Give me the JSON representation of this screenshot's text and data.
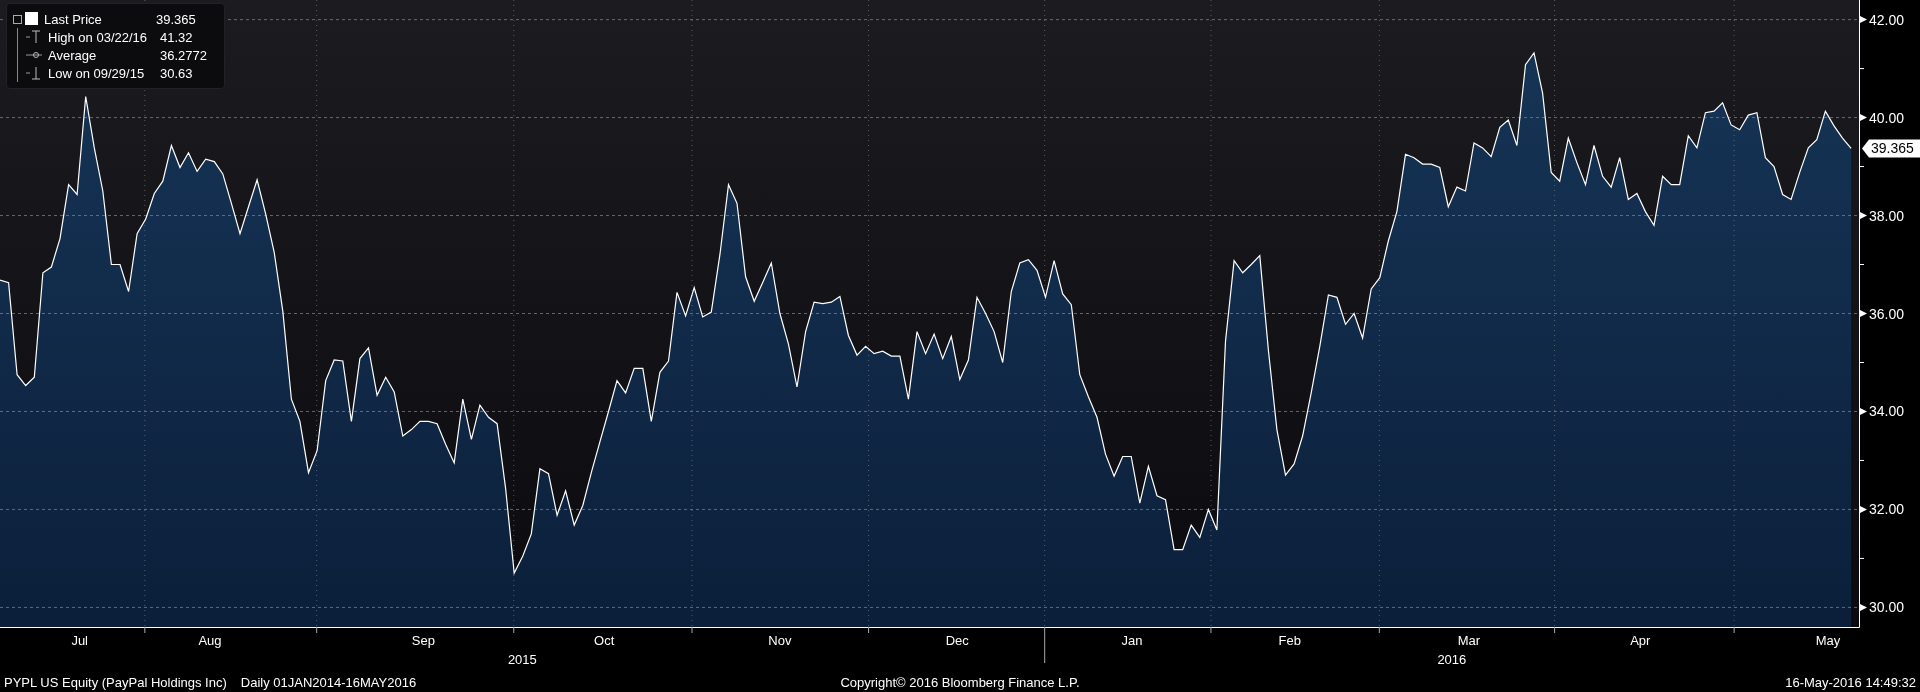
{
  "legend": [
    {
      "kind": "last",
      "value": "39.365"
    },
    {
      "kind": "high",
      "label": "High on 03/22/16",
      "value": "41.32"
    },
    {
      "kind": "average",
      "label": "Average",
      "value": "36.2772"
    },
    {
      "kind": "low",
      "label": "Low on 09/29/15",
      "value": "30.63"
    }
  ],
  "last_price_tag": "39.365",
  "x_axis_months": [
    "Jul",
    "Aug",
    "Sep",
    "Oct",
    "Nov",
    "Dec",
    "Jan",
    "Feb",
    "Mar",
    "Apr",
    "May"
  ],
  "chart_data": {
    "type": "area",
    "grid": true,
    "ylim": [
      29.6,
      42.4
    ],
    "yticks": [
      {
        "value": 30,
        "label": "30.00"
      },
      {
        "value": 32,
        "label": "32.00"
      },
      {
        "value": 34,
        "label": "34.00"
      },
      {
        "value": 36,
        "label": "36.00"
      },
      {
        "value": 38,
        "label": "38.00"
      },
      {
        "value": 40,
        "label": "40.00"
      },
      {
        "value": 42,
        "label": "42.00"
      }
    ],
    "series": [
      {
        "name": "Last Price",
        "color": "#ffffff",
        "values": [
          36.68,
          36.63,
          34.75,
          34.53,
          34.7,
          36.83,
          36.95,
          37.53,
          38.63,
          38.43,
          40.43,
          39.38,
          38.5,
          37.0,
          37.0,
          36.45,
          37.63,
          37.93,
          38.45,
          38.7,
          39.43,
          38.98,
          39.28,
          38.9,
          39.15,
          39.1,
          38.85,
          38.25,
          37.63,
          38.18,
          38.73,
          38.03,
          37.25,
          36.05,
          34.25,
          33.8,
          32.75,
          33.2,
          34.63,
          35.05,
          35.03,
          33.8,
          35.08,
          35.3,
          34.33,
          34.7,
          34.4,
          33.5,
          33.63,
          33.8,
          33.8,
          33.75,
          33.33,
          32.95,
          34.25,
          33.43,
          34.13,
          33.88,
          33.75,
          32.43,
          30.7,
          31.05,
          31.5,
          32.83,
          32.73,
          31.88,
          32.38,
          31.68,
          32.08,
          32.75,
          33.38,
          34.0,
          34.63,
          34.38,
          34.88,
          34.88,
          33.8,
          34.8,
          35.03,
          36.43,
          35.95,
          36.53,
          35.93,
          36.03,
          37.2,
          38.63,
          38.25,
          36.75,
          36.25,
          36.63,
          37.03,
          36.0,
          35.38,
          34.5,
          35.63,
          36.23,
          36.2,
          36.23,
          36.35,
          35.55,
          35.15,
          35.33,
          35.18,
          35.23,
          35.13,
          35.13,
          34.25,
          35.63,
          35.18,
          35.58,
          35.08,
          35.53,
          34.65,
          35.05,
          36.33,
          36.0,
          35.63,
          35.0,
          36.45,
          37.03,
          37.1,
          36.88,
          36.33,
          37.08,
          36.4,
          36.18,
          34.75,
          34.3,
          33.88,
          33.13,
          32.68,
          33.08,
          33.08,
          32.13,
          32.88,
          32.28,
          32.2,
          31.18,
          31.18,
          31.68,
          31.43,
          32.0,
          31.58,
          35.43,
          37.08,
          36.83,
          37.0,
          37.18,
          35.25,
          33.63,
          32.7,
          32.93,
          33.5,
          34.38,
          35.33,
          36.38,
          36.33,
          35.78,
          36.0,
          35.5,
          36.5,
          36.73,
          37.48,
          38.08,
          39.25,
          39.18,
          39.05,
          39.05,
          38.98,
          38.18,
          38.58,
          38.5,
          39.48,
          39.38,
          39.2,
          39.8,
          39.95,
          39.43,
          41.08,
          41.32,
          40.5,
          38.88,
          38.7,
          39.58,
          39.08,
          38.63,
          39.43,
          38.8,
          38.58,
          39.18,
          38.33,
          38.45,
          38.08,
          37.8,
          38.8,
          38.63,
          38.63,
          39.63,
          39.38,
          40.1,
          40.13,
          40.3,
          39.85,
          39.75,
          40.05,
          40.1,
          39.18,
          39.0,
          38.43,
          38.33,
          38.88,
          39.38,
          39.55,
          40.13,
          39.83,
          39.58,
          39.37
        ]
      }
    ]
  },
  "x_axis_years": [
    "2015",
    "2016"
  ],
  "footer": {
    "left": [
      "PYPL US Equity (PayPal Holdings Inc)",
      "Daily 01JAN2014-16MAY2016"
    ],
    "center": "Copyright© 2016 Bloomberg Finance L.P.",
    "right": "16-May-2016 14:49:32"
  }
}
